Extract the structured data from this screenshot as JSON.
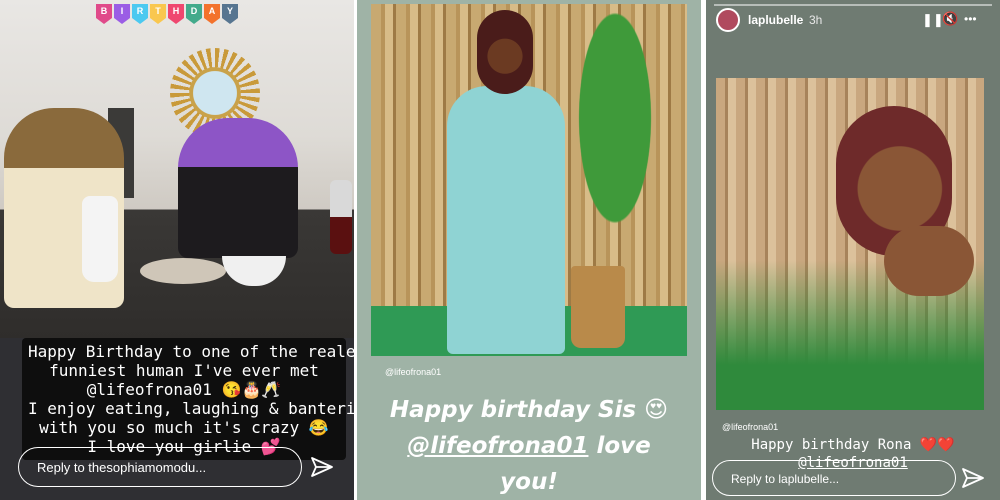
{
  "panel1": {
    "banner_letters": [
      "B",
      "I",
      "R",
      "T",
      "H",
      "D",
      "A",
      "Y"
    ],
    "banner_colors": [
      "#e04a8a",
      "#9b5de5",
      "#4cc9f0",
      "#f9c74f",
      "#ef476f",
      "#43aa8b",
      "#f3722c",
      "#577590"
    ],
    "caption_lines": [
      "Happy Birthday to one of the realest,",
      "funniest human I've ever met",
      "@lifeofrona01 😘🎂🥂",
      "I enjoy eating, laughing & bantering",
      "with you so much it's crazy 😂",
      "I love you girlie 💕"
    ],
    "reply_placeholder": "Reply to thesophiamomodu...",
    "send_icon": "paper-plane-icon"
  },
  "panel2": {
    "handle": "@lifeofrona01",
    "caption_line1": "Happy birthday Sis 😍",
    "caption_mention": "@lifeofrona01",
    "caption_mention_tail": " love",
    "caption_line3": "you!"
  },
  "panel3": {
    "username": "laplubelle",
    "time": "3h",
    "handle": "@lifeofrona01",
    "caption_line1": "Happy birthday Rona",
    "caption_hearts": "❤️❤️",
    "caption_mention": "@lifeofrona01",
    "reply_placeholder": "Reply to laplubelle...",
    "pause_icon": "❚❚",
    "mute_icon": "🔇",
    "more_icon": "•••"
  }
}
